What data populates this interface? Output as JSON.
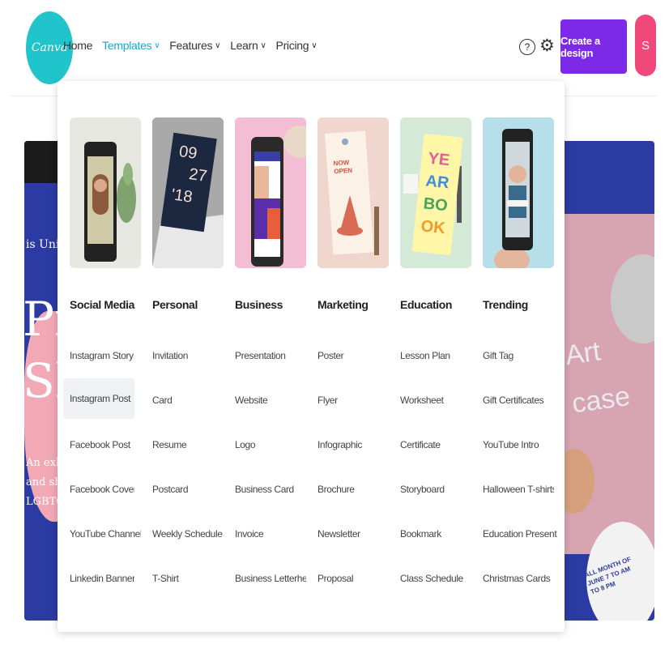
{
  "brand": {
    "logo_text": "Canva"
  },
  "nav": {
    "items": [
      {
        "label": "Home",
        "chevron": ""
      },
      {
        "label": "Templates",
        "chevron": "∨"
      },
      {
        "label": "Features",
        "chevron": "∨"
      },
      {
        "label": "Learn",
        "chevron": "∨"
      },
      {
        "label": "Pricing",
        "chevron": "∨"
      }
    ],
    "create_label": "Create a design",
    "avatar_letter": "S",
    "help_icon": "help-icon",
    "settings_icon": "gear-icon"
  },
  "colors": {
    "accent": "#7d2ae8",
    "logo": "#20c4cb",
    "active_nav": "#19a7cc",
    "avatar": "#f0487a",
    "hero": "#2c3ba4"
  },
  "hero": {
    "left_lines": [
      "is Univers",
      "Pri",
      "Sh",
      "An exhibit t",
      "and showc",
      "LGBTQ+ s"
    ],
    "right_lines": [
      "Art",
      "case"
    ],
    "poster_lines": [
      "ALL MONTH OF",
      "JUNE 7 TO AM",
      "TO 8 PM"
    ]
  },
  "templates_menu": {
    "columns": [
      {
        "heading": "Social Media",
        "items": [
          "Instagram Story",
          "Instagram Post",
          "Facebook Post",
          "Facebook Cover",
          "YouTube Channel Art",
          "Linkedin Banner"
        ]
      },
      {
        "heading": "Personal",
        "items": [
          "Invitation",
          "Card",
          "Resume",
          "Postcard",
          "Weekly Schedule Pla...",
          "T-Shirt"
        ]
      },
      {
        "heading": "Business",
        "items": [
          "Presentation",
          "Website",
          "Logo",
          "Business Card",
          "Invoice",
          "Business Letterhead"
        ]
      },
      {
        "heading": "Marketing",
        "items": [
          "Poster",
          "Flyer",
          "Infographic",
          "Brochure",
          "Newsletter",
          "Proposal"
        ]
      },
      {
        "heading": "Education",
        "items": [
          "Lesson Plan",
          "Worksheet",
          "Certificate",
          "Storyboard",
          "Bookmark",
          "Class Schedule"
        ]
      },
      {
        "heading": "Trending",
        "items": [
          "Gift Tag",
          "Gift Certificates",
          "YouTube Intro",
          "Halloween T-shirts",
          "Education Presentati...",
          "Christmas Cards"
        ]
      }
    ],
    "hovered_item": "Instagram Post",
    "thumb_text": {
      "personal": [
        "09",
        "27",
        "'18"
      ],
      "marketing": [
        "NOW",
        "OPEN"
      ],
      "education": [
        "YE",
        "AR",
        "BO",
        "OK"
      ]
    }
  }
}
